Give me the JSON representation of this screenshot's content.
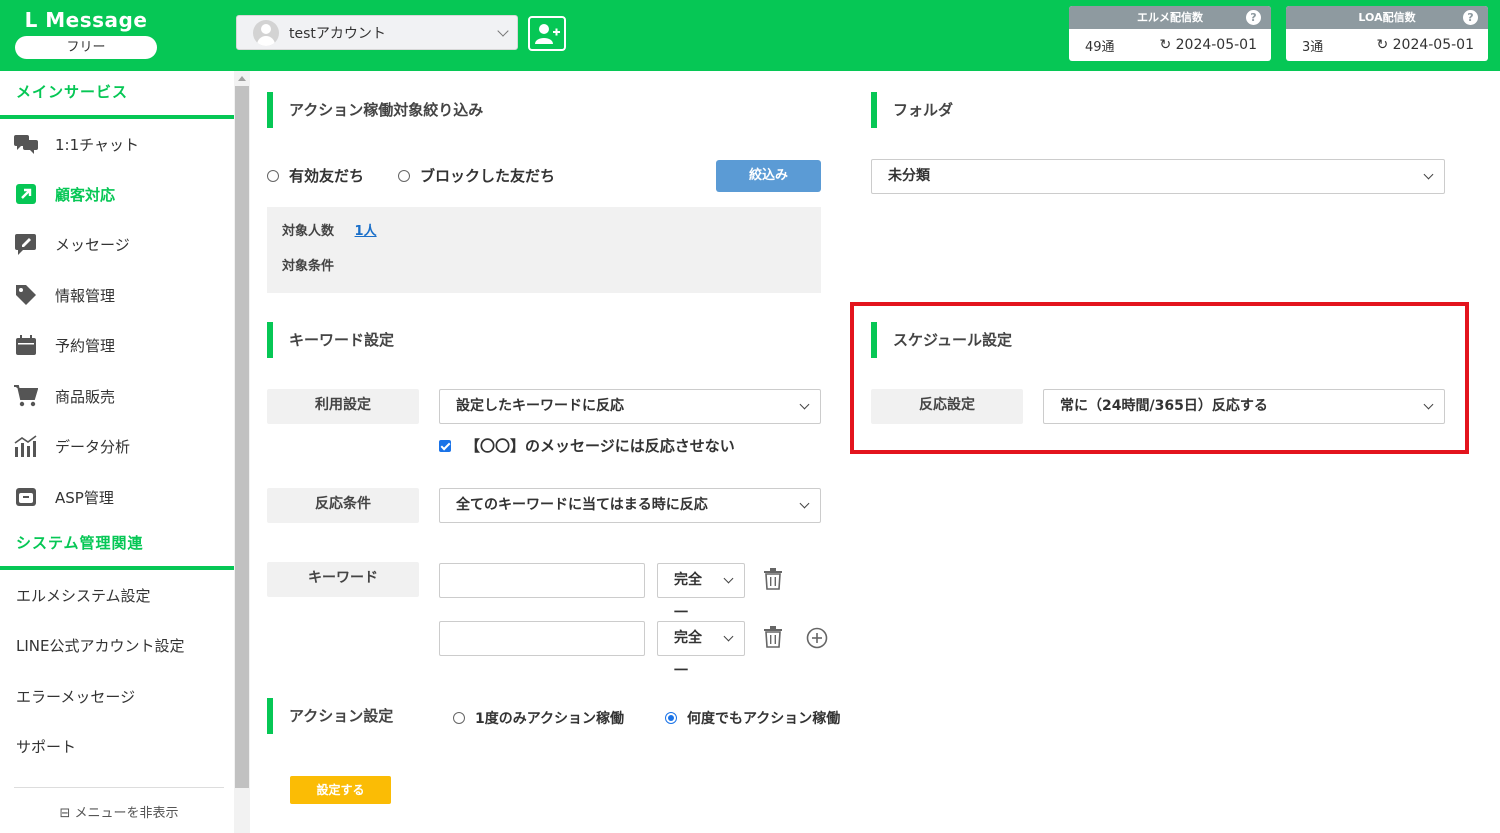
{
  "header": {
    "logo": "L Message",
    "plan": "フリー",
    "account_name": "testアカウント",
    "counters": [
      {
        "title": "エルメ配信数",
        "count": "49通",
        "date": "2024-05-01"
      },
      {
        "title": "LOA配信数",
        "count": "3通",
        "date": "2024-05-01"
      }
    ],
    "help_glyph": "?"
  },
  "sidebar": {
    "main_section": "メインサービス",
    "items": [
      {
        "label": "1:1チャット",
        "icon": "chat-icon"
      },
      {
        "label": "顧客対応",
        "icon": "external-link-icon"
      },
      {
        "label": "メッセージ",
        "icon": "message-edit-icon"
      },
      {
        "label": "情報管理",
        "icon": "tag-icon"
      },
      {
        "label": "予約管理",
        "icon": "calendar-icon"
      },
      {
        "label": "商品販売",
        "icon": "cart-icon"
      },
      {
        "label": "データ分析",
        "icon": "bar-chart-icon"
      },
      {
        "label": "ASP管理",
        "icon": "box-icon"
      }
    ],
    "system_section": "システム管理関連",
    "system_items": [
      "エルメシステム設定",
      "LINE公式アカウント設定",
      "エラーメッセージ",
      "サポート"
    ],
    "hide_menu": "メニューを非表示",
    "active_color": "#06c755"
  },
  "main": {
    "filter": {
      "title": "アクション稼働対象絞り込み",
      "radio_active": "有効友だち",
      "radio_blocked": "ブロックした友だち",
      "filter_button": "絞込み",
      "target_count_label": "対象人数",
      "target_count_value": "1人",
      "target_condition_label": "対象条件"
    },
    "folder": {
      "title": "フォルダ",
      "value": "未分類"
    },
    "keyword": {
      "title": "キーワード設定",
      "usage_label": "利用設定",
      "usage_value": "設定したキーワードに反応",
      "checkbox_label": "【〇〇】のメッセージには反応させない",
      "condition_label": "反応条件",
      "condition_value": "全てのキーワードに当てはまる時に反応",
      "keyword_label": "キーワード",
      "match_1": "完全一",
      "match_2": "完全一"
    },
    "schedule": {
      "title": "スケジュール設定",
      "reaction_label": "反応設定",
      "reaction_value": "常に（24時間/365日）反応する"
    },
    "action": {
      "title": "アクション設定",
      "once": "1度のみアクション稼働",
      "anytime": "何度でもアクション稼働",
      "selected": "anytime"
    },
    "submit_button": "設定する"
  },
  "colors": {
    "brand_green": "#06c755",
    "filter_blue": "#5b9bd5",
    "submit_yellow": "#fbbc05",
    "highlight_red": "#e3141d"
  }
}
